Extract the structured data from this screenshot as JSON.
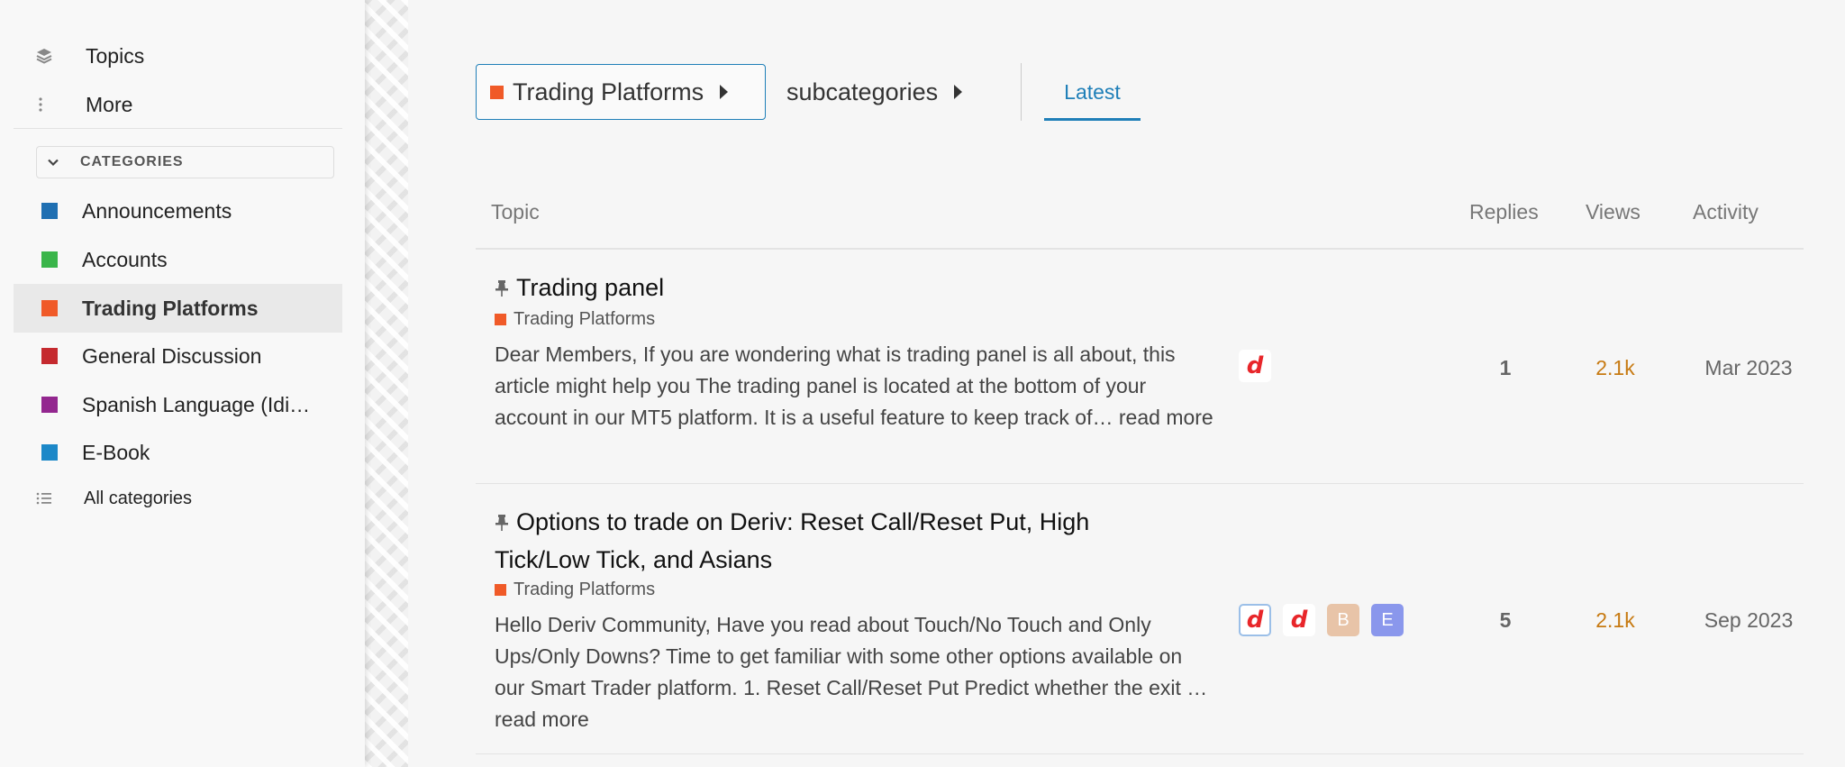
{
  "sidebar": {
    "topics_label": "Topics",
    "more_label": "More",
    "categories_header": "CATEGORIES",
    "categories": [
      {
        "label": "Announcements",
        "color": "#1f6fb2"
      },
      {
        "label": "Accounts",
        "color": "#3ab54a"
      },
      {
        "label": "Trading Platforms",
        "color": "#f05a28",
        "active": true
      },
      {
        "label": "General Discussion",
        "color": "#c52a2f"
      },
      {
        "label": "Spanish Language (Idi…",
        "color": "#93278f"
      },
      {
        "label": "E-Book",
        "color": "#1c88c8"
      }
    ],
    "all_categories_label": "All categories"
  },
  "header": {
    "category_crumb": "Trading Platforms",
    "category_color": "#f05a28",
    "subcategory_crumb": "subcategories",
    "tab_latest": "Latest"
  },
  "table": {
    "columns": {
      "topic": "Topic",
      "replies": "Replies",
      "views": "Views",
      "activity": "Activity"
    },
    "rows": [
      {
        "title": "Trading panel",
        "category": "Trading Platforms",
        "excerpt": "Dear Members, If you are wondering what is trading panel is all about, this article might help you The trading panel is located at the bottom of your account in our MT5 platform. It is a useful feature to keep track of…",
        "read_more": "read more",
        "replies": "1",
        "views": "2.1k",
        "activity": "Mar 2023"
      },
      {
        "title": "Options to trade on Deriv: Reset Call/Reset Put, High Tick/Low Tick, and Asians",
        "category": "Trading Platforms",
        "excerpt": "Hello Deriv Community, Have you read about Touch/No Touch and Only Ups/Only Downs? Time to get familiar with some other options available on our Smart Trader platform. 1. Reset Call/Reset Put Predict whether the exit …",
        "read_more": "read more",
        "replies": "5",
        "views": "2.1k",
        "activity": "Sep 2023",
        "avatar_letters": [
          "B",
          "E"
        ],
        "avatar_colors": [
          "#e8c4a8",
          "#8a97ec"
        ]
      }
    ]
  }
}
